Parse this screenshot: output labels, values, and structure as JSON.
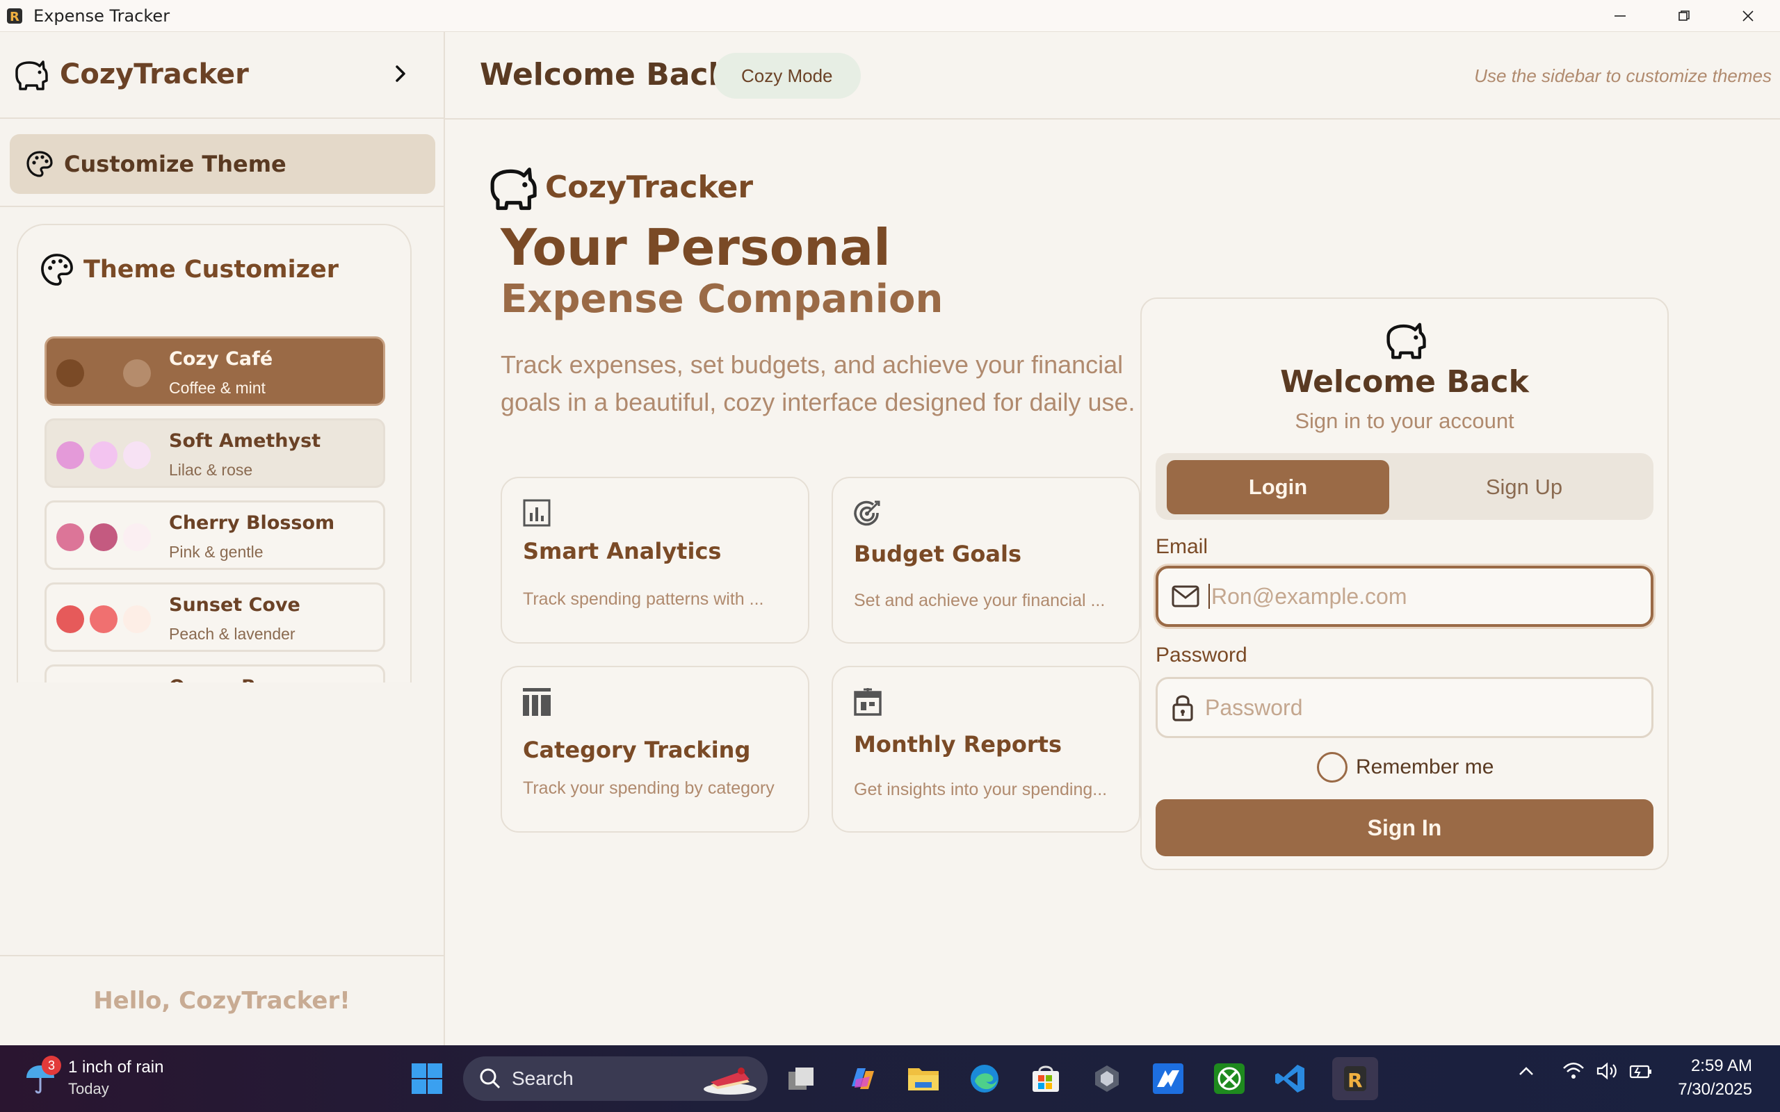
{
  "window": {
    "title": "Expense Tracker"
  },
  "sidebar": {
    "brand": "CozyTracker",
    "customize_label": "Customize Theme",
    "theme_panel_title": "Theme Customizer",
    "themes": [
      {
        "name": "Cozy Café",
        "subtitle": "Coffee & mint",
        "colors": [
          "#7a4a26",
          "#9a6a46",
          "#b58c6c"
        ]
      },
      {
        "name": "Soft Amethyst",
        "subtitle": "Lilac & rose",
        "colors": [
          "#e49ad9",
          "#f3c4f0",
          "#f7e2f4"
        ]
      },
      {
        "name": "Cherry Blossom",
        "subtitle": "Pink & gentle",
        "colors": [
          "#dc7598",
          "#c45a80",
          "#fbeff2"
        ]
      },
      {
        "name": "Sunset Cove",
        "subtitle": "Peach & lavender",
        "colors": [
          "#e65a5a",
          "#f07070",
          "#fdeee6"
        ]
      },
      {
        "name": "Ocean Breeze",
        "subtitle": "",
        "colors": [
          "#6aa0c4",
          "#8cc0dc",
          "#e6f2f8"
        ]
      }
    ],
    "footer_greeting": "Hello, CozyTracker!"
  },
  "header": {
    "title": "Welcome Back",
    "mode_pill": "Cozy Mode",
    "hint": "Use the sidebar to customize themes"
  },
  "hero": {
    "brand": "CozyTracker",
    "headline": "Your Personal",
    "subheadline": "Expense Companion",
    "description": "Track expenses, set budgets, and achieve your financial goals in a beautiful, cozy interface designed for daily use."
  },
  "features": [
    {
      "title": "Smart Analytics",
      "desc": "Track spending patterns with ...",
      "icon": "bar-chart-icon"
    },
    {
      "title": "Budget Goals",
      "desc": "Set and achieve your financial ...",
      "icon": "target-icon"
    },
    {
      "title": "Category Tracking",
      "desc": "Track your spending by category",
      "icon": "columns-icon"
    },
    {
      "title": "Monthly Reports",
      "desc": "Get insights into your spending...",
      "icon": "calendar-report-icon"
    }
  ],
  "auth": {
    "title": "Welcome Back",
    "subtitle": "Sign in to your account",
    "tab_login": "Login",
    "tab_signup": "Sign Up",
    "email_label": "Email",
    "email_placeholder": "Ron@example.com",
    "password_label": "Password",
    "password_placeholder": "Password",
    "remember_label": "Remember me",
    "signin_label": "Sign In"
  },
  "taskbar": {
    "weather_line1": "1 inch of rain",
    "weather_line2": "Today",
    "weather_badge": "3",
    "search_label": "Search",
    "time": "2:59 AM",
    "date": "7/30/2025"
  },
  "colors": {
    "accent": "#9a6a46",
    "brand_text": "#7a4a26",
    "background": "#f7f4ef"
  }
}
